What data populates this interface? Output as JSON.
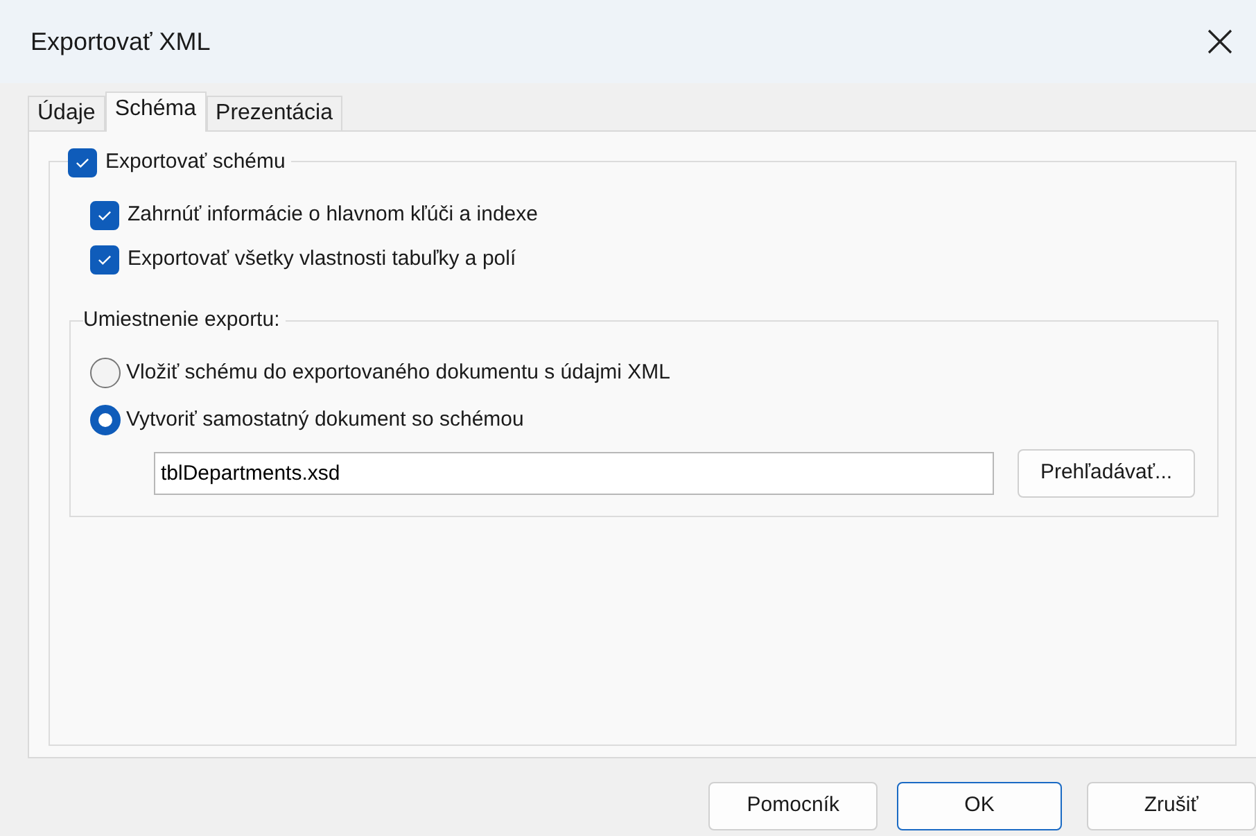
{
  "window": {
    "title": "Exportovať XML"
  },
  "tabs": [
    {
      "label": "Údaje",
      "selected": false
    },
    {
      "label": "Schéma",
      "selected": true
    },
    {
      "label": "Prezentácia",
      "selected": false
    }
  ],
  "export_schema": {
    "label": "Exportovať schému",
    "checked": true
  },
  "schema_options": [
    {
      "label": "Zahrnúť informácie o hlavnom kľúči a indexe",
      "checked": true
    },
    {
      "label": "Exportovať všetky vlastnosti tabuľky a polí",
      "checked": true
    }
  ],
  "export_location": {
    "legend": "Umiestnenie exportu:",
    "options": [
      {
        "label": "Vložiť schému do exportovaného dokumentu s údajmi XML",
        "selected": false
      },
      {
        "label": "Vytvoriť samostatný dokument so schémou",
        "selected": true
      }
    ],
    "file": {
      "value": "tblDepartments.xsd"
    },
    "browse_button": "Prehľadávať..."
  },
  "buttons": [
    {
      "label": "Pomocník",
      "default": false
    },
    {
      "label": "OK",
      "default": true
    },
    {
      "label": "Zrušiť",
      "default": false
    }
  ]
}
